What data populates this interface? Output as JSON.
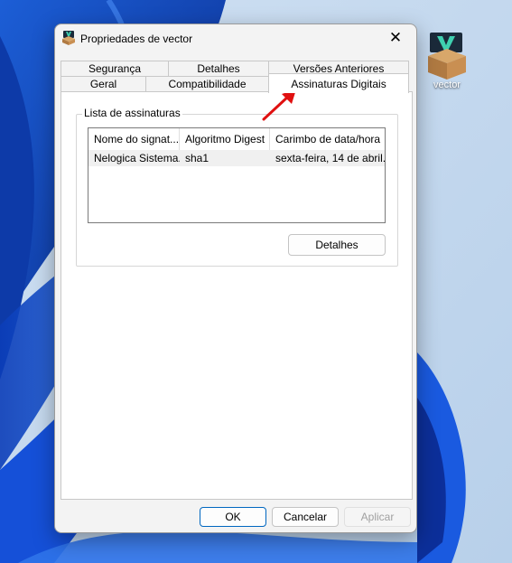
{
  "window": {
    "title": "Propriedades de vector"
  },
  "desktop": {
    "icon_label": "vector"
  },
  "tabs": {
    "row1": [
      "Segurança",
      "Detalhes",
      "Versões Anteriores"
    ],
    "row2": [
      "Geral",
      "Compatibilidade",
      "Assinaturas Digitais"
    ]
  },
  "signatures": {
    "group_label": "Lista de assinaturas",
    "columns": [
      "Nome do signat...",
      "Algoritmo Digest",
      "Carimbo de data/hora"
    ],
    "rows": [
      [
        "Nelogica Sistema...",
        "sha1",
        "sexta-feira, 14 de abril..."
      ]
    ],
    "details_label": "Detalhes"
  },
  "buttons": {
    "ok": "OK",
    "cancel": "Cancelar",
    "apply": "Aplicar"
  },
  "colors": {
    "accent": "#0067c0",
    "annotation_arrow": "#e01010"
  }
}
